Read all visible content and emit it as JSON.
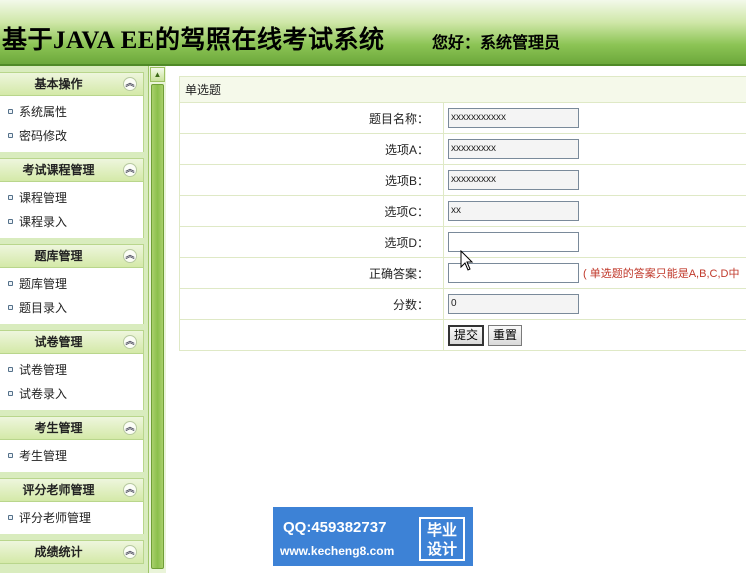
{
  "header": {
    "title": "基于JAVA EE的驾照在线考试系统",
    "greeting": "您好：系统管理员"
  },
  "sidebar": {
    "groups": [
      {
        "title": "基本操作",
        "items": [
          "系统属性",
          "密码修改"
        ]
      },
      {
        "title": "考试课程管理",
        "items": [
          "课程管理",
          "课程录入"
        ]
      },
      {
        "title": "题库管理",
        "items": [
          "题库管理",
          "题目录入"
        ]
      },
      {
        "title": "试卷管理",
        "items": [
          "试卷管理",
          "试卷录入"
        ]
      },
      {
        "title": "考生管理",
        "items": [
          "考生管理"
        ]
      },
      {
        "title": "评分老师管理",
        "items": [
          "评分老师管理"
        ]
      },
      {
        "title": "成绩统计",
        "items": []
      }
    ],
    "toggle_icon": "collapse-chevrons-icon"
  },
  "form": {
    "caption": "单选题",
    "fields": [
      {
        "label": "题目名称：",
        "value": "xxxxxxxxxxx"
      },
      {
        "label": "选项A：",
        "value": "xxxxxxxxx"
      },
      {
        "label": "选项B：",
        "value": "xxxxxxxxx"
      },
      {
        "label": "选项C：",
        "value": "xx"
      },
      {
        "label": "选项D：",
        "value": ""
      },
      {
        "label": "正确答案：",
        "value": "",
        "hint": "( 单选题的答案只能是A,B,C,D中"
      },
      {
        "label": "分数：",
        "value": "0"
      }
    ],
    "submit_label": "提交",
    "reset_label": "重置"
  },
  "watermark": {
    "qq": "QQ:459382737",
    "url": "www.kecheng8.com",
    "badge_line1": "毕业",
    "badge_line2": "设计"
  },
  "colors": {
    "header_green": "#6ca83b",
    "sidebar_bg": "#d9ecbe",
    "hint_red": "#c0392b",
    "watermark_blue": "#3d82d6"
  }
}
